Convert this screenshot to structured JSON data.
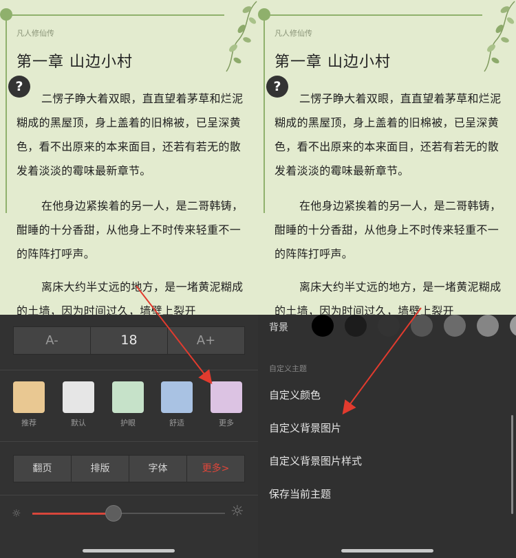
{
  "book": {
    "name": "凡人修仙传",
    "chapter_title": "第一章 山边小村",
    "paragraphs": [
      "二愣子睁大着双眼，直直望着茅草和烂泥糊成的黑屋顶，身上盖着的旧棉被，已呈深黄色，看不出原来的本来面目，还若有若无的散发着淡淡的霉味最新章节。",
      "在他身边紧挨着的另一人，是二哥韩铸，酣睡的十分香甜，从他身上不时传来轻重不一的阵阵打呼声。",
      "离床大约半丈远的地方，是一堵黄泥糊成的土墙，因为时间过久，墙壁上裂开"
    ],
    "help_symbol": "?"
  },
  "font_control": {
    "decrease_label": "A-",
    "size_value": "18",
    "increase_label": "A+"
  },
  "themes": [
    {
      "label": "推荐",
      "color": "#e9c892"
    },
    {
      "label": "默认",
      "color": "#e6e6e6"
    },
    {
      "label": "护眼",
      "color": "#c6e2c9"
    },
    {
      "label": "舒适",
      "color": "#a9c2e3"
    },
    {
      "label": "更多",
      "color": "#dcc3e3"
    }
  ],
  "tabs": [
    {
      "label": "翻页"
    },
    {
      "label": "排版"
    },
    {
      "label": "字体"
    },
    {
      "label": "更多>"
    }
  ],
  "brightness": {
    "level": 0.42,
    "low_icon": "sun-small-icon",
    "high_icon": "sun-large-icon"
  },
  "right_sheet": {
    "background_label": "背景",
    "background_colors": [
      "#000000",
      "#1c1c1c",
      "#333333",
      "#555555",
      "#6b6b6b",
      "#858585",
      "#9c9c9c"
    ],
    "section_title": "自定义主题",
    "menu_items": [
      {
        "label": "自定义颜色"
      },
      {
        "label": "自定义背景图片"
      },
      {
        "label": "自定义背景图片样式"
      },
      {
        "label": "保存当前主题"
      }
    ]
  },
  "colors": {
    "page_bg": "#e3ebcf",
    "accent_red": "#d8463b",
    "arrow_red": "#e23b2e"
  }
}
